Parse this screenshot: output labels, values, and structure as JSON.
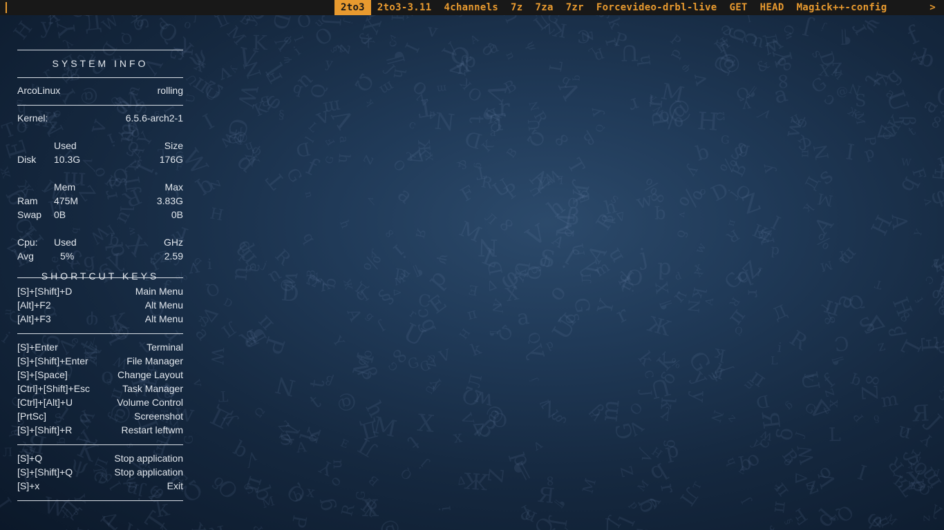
{
  "launcher": {
    "items": [
      "2to3",
      "2to3-3.11",
      "4channels",
      "7z",
      "7za",
      "7zr",
      "Forcevideo-drbl-live",
      "GET",
      "HEAD",
      "Magick++-config"
    ],
    "selected_index": 0,
    "more_indicator": ">"
  },
  "system_info": {
    "heading": "SYSTEM INFO",
    "distro": "ArcoLinux",
    "release": "rolling",
    "kernel_label": "Kernel:",
    "kernel_value": "6.5.6-arch2-1",
    "disk": {
      "used_header": "Used",
      "size_header": "Size",
      "label": "Disk",
      "used": "10.3G",
      "size": "176G"
    },
    "memory": {
      "mem_header": "Mem",
      "max_header": "Max",
      "ram_label": "Ram",
      "ram_used": "475M",
      "ram_max": "3.83G",
      "swap_label": "Swap",
      "swap_used": "0B",
      "swap_max": "0B"
    },
    "cpu": {
      "label": "Cpu:",
      "used_header": "Used",
      "ghz_header": "GHz",
      "avg_label": "Avg",
      "avg_used": "5%",
      "avg_ghz": "2.59"
    }
  },
  "shortcut_keys": {
    "heading": "SHORTCUT KEYS",
    "group1": [
      {
        "keys": "[S]+[Shift]+D",
        "action": "Main Menu"
      },
      {
        "keys": "[Alt]+F2",
        "action": "Alt Menu"
      },
      {
        "keys": "[Alt]+F3",
        "action": "Alt Menu"
      }
    ],
    "group2": [
      {
        "keys": "[S]+Enter",
        "action": "Terminal"
      },
      {
        "keys": "[S]+[Shift]+Enter",
        "action": "File Manager"
      },
      {
        "keys": "[S]+[Space]",
        "action": "Change Layout"
      },
      {
        "keys": "[Ctrl]+[Shift]+Esc",
        "action": "Task Manager"
      },
      {
        "keys": "[Ctrl]+[Alt]+U",
        "action": "Volume Control"
      },
      {
        "keys": "[PrtSc]",
        "action": "Screenshot"
      },
      {
        "keys": "[S]+[Shift]+R",
        "action": "Restart leftwm"
      }
    ],
    "group3": [
      {
        "keys": "[S]+Q",
        "action": "Stop application"
      },
      {
        "keys": "[S]+[Shift]+Q",
        "action": "Stop application"
      },
      {
        "keys": "[S]+x",
        "action": "Exit"
      }
    ]
  },
  "colors": {
    "accent": "#e89a2f",
    "bar_background": "#181818",
    "wallpaper": "#1d3553"
  }
}
